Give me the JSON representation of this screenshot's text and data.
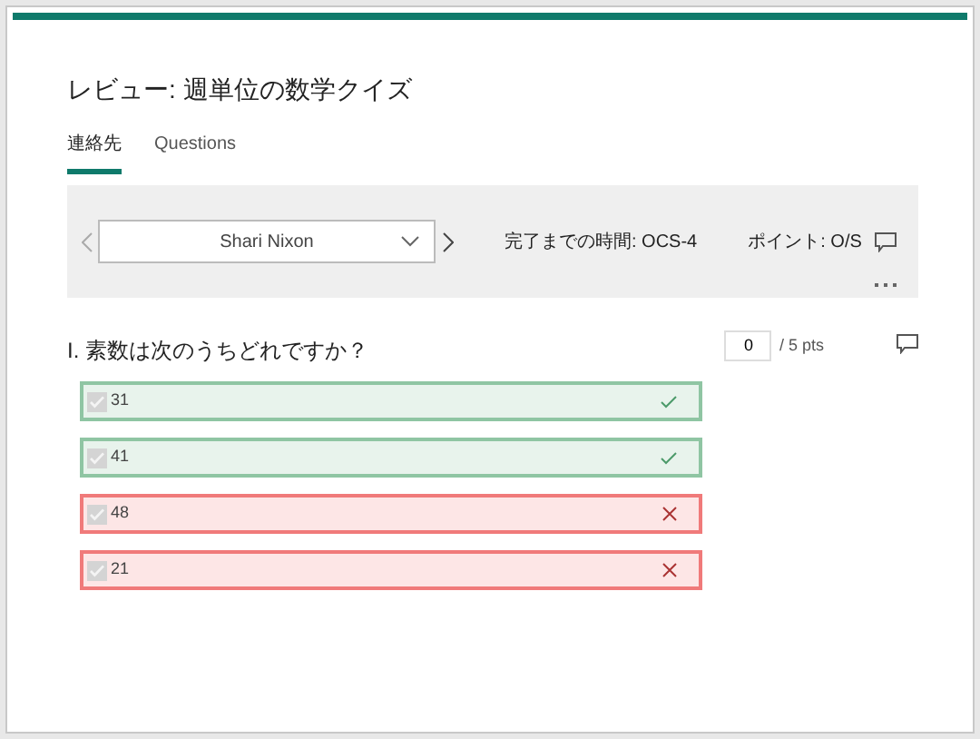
{
  "title": "レビュー: 週単位の数学クイズ",
  "tabs": [
    {
      "label": "連絡先",
      "selected": true
    },
    {
      "label": "Questions",
      "selected": false
    }
  ],
  "responder": {
    "name": "Shari Nixon",
    "time_label": "完了までの時間: OCS-4",
    "points_label": "ポイント: O/S"
  },
  "question": {
    "text": "I. 素数は次のうちどれですか？",
    "score": "0",
    "max": "/ 5 pts",
    "options": [
      {
        "label": "31",
        "checked": true,
        "kind": "correct"
      },
      {
        "label": "41",
        "checked": true,
        "kind": "correct"
      },
      {
        "label": "48",
        "checked": true,
        "kind": "incorrect"
      },
      {
        "label": "21",
        "checked": true,
        "kind": "incorrect"
      }
    ]
  }
}
